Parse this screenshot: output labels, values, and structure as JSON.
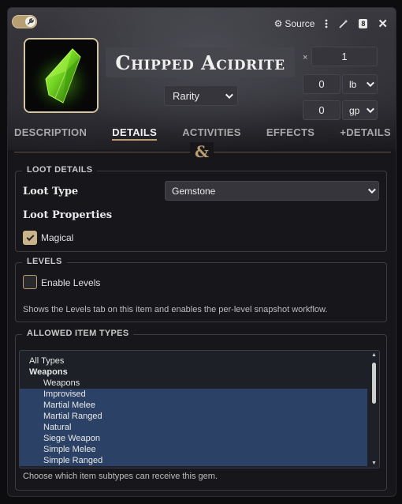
{
  "topbar": {
    "source_label": "Source"
  },
  "item": {
    "name": "Chipped Acidrite",
    "rarity": "Rarity"
  },
  "quantity": {
    "symbol": "×",
    "value": "1"
  },
  "weight": {
    "value": "0",
    "unit": "lb"
  },
  "price": {
    "value": "0",
    "unit": "gp"
  },
  "tabs": [
    {
      "label": "DESCRIPTION",
      "active": false
    },
    {
      "label": "DETAILS",
      "active": true
    },
    {
      "label": "ACTIVITIES",
      "active": false
    },
    {
      "label": "EFFECTS",
      "active": false
    },
    {
      "label": "+DETAILS",
      "active": false
    }
  ],
  "divider_logo": "&",
  "loot_details": {
    "legend": "LOOT DETAILS",
    "loot_type_label": "Loot Type",
    "loot_type_value": "Gemstone",
    "properties_label": "Loot Properties",
    "magical_label": "Magical",
    "magical_checked": true
  },
  "levels": {
    "legend": "LEVELS",
    "enable_label": "Enable Levels",
    "enabled": false,
    "hint": "Shows the Levels tab on this item and enables the per-level snapshot workflow."
  },
  "allowed_types": {
    "legend": "ALLOWED ITEM TYPES",
    "options": [
      {
        "label": "All Types",
        "kind": "plain",
        "selected": false
      },
      {
        "label": "Weapons",
        "kind": "group",
        "selected": false
      },
      {
        "label": "Weapons",
        "kind": "indent",
        "selected": false
      },
      {
        "label": "Improvised",
        "kind": "indent",
        "selected": true
      },
      {
        "label": "Martial Melee",
        "kind": "indent",
        "selected": true
      },
      {
        "label": "Martial Ranged",
        "kind": "indent",
        "selected": true
      },
      {
        "label": "Natural",
        "kind": "indent",
        "selected": true
      },
      {
        "label": "Siege Weapon",
        "kind": "indent",
        "selected": true
      },
      {
        "label": "Simple Melee",
        "kind": "indent",
        "selected": true
      },
      {
        "label": "Simple Ranged",
        "kind": "indent",
        "selected": true
      }
    ],
    "hint": "Choose which item subtypes can receive this gem."
  },
  "colors": {
    "accent": "#b79f73",
    "selection": "#2b4266",
    "gem_green": "#6fd21f"
  }
}
